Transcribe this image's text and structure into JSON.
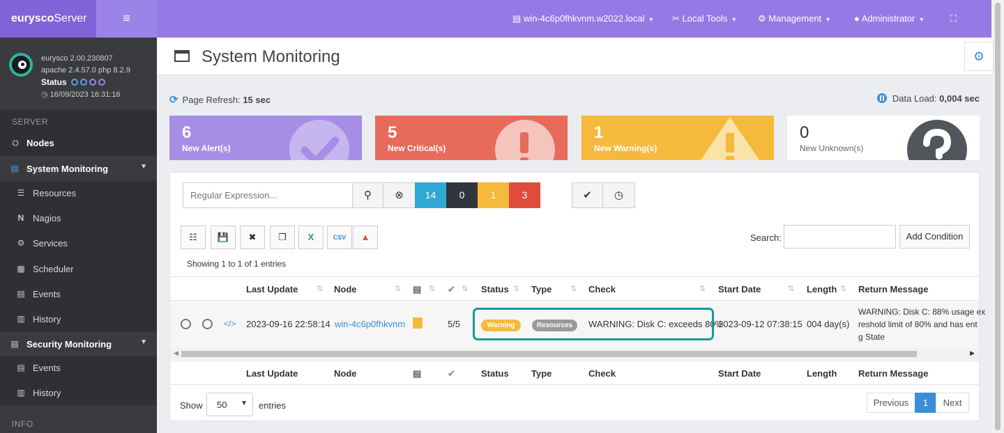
{
  "brand": {
    "name_bold": "eurysco",
    "name_thin": "Server"
  },
  "sidebar": {
    "version": "eurysco 2.00.230807",
    "stack": "apache 2.4.57.0  php 8.2.9",
    "status_label": "Status",
    "timestamp": "16/09/2023 16:31:16",
    "section_server": "SERVER",
    "nodes": "Nodes",
    "system_monitoring": "System Monitoring",
    "sys_items": [
      "Resources",
      "Nagios",
      "Services",
      "Scheduler",
      "Events",
      "History"
    ],
    "security_monitoring": "Security Monitoring",
    "sec_items": [
      "Events",
      "History"
    ],
    "section_info": "INFO"
  },
  "topbar": {
    "host": "win-4c6p0fhkvnm.w2022.local",
    "local_tools": "Local Tools",
    "management": "Management",
    "user": "Administrator"
  },
  "page": {
    "title": "System Monitoring",
    "refresh_label": "Page Refresh:",
    "refresh_value": "15 sec",
    "data_load_label": "Data Load:",
    "data_load_value": "0,004 sec"
  },
  "stats": [
    {
      "num": "6",
      "label": "New Alert(s)",
      "color": "#a78de6"
    },
    {
      "num": "5",
      "label": "New Critical(s)",
      "color": "#e76a5b"
    },
    {
      "num": "1",
      "label": "New Warning(s)",
      "color": "#f5b93b"
    },
    {
      "num": "0",
      "label": "New Unknown(s)",
      "color": "#ffffff"
    }
  ],
  "filters": {
    "regex_placeholder": "Regular Expression...",
    "counts": [
      {
        "value": "14",
        "color": "#2fa8d6"
      },
      {
        "value": "0",
        "color": "#31353d"
      },
      {
        "value": "1",
        "color": "#f5b93b"
      },
      {
        "value": "3",
        "color": "#e04c3a"
      }
    ]
  },
  "toolbar": {
    "search_label": "Search:",
    "add_condition": "Add Condition"
  },
  "table": {
    "showing": "Showing 1 to 1 of 1 entries",
    "headers": {
      "last_update": "Last Update",
      "node": "Node",
      "status": "Status",
      "type": "Type",
      "check": "Check",
      "start_date": "Start Date",
      "length": "Length",
      "return_message": "Return Message"
    },
    "row": {
      "last_update": "2023-09-16 22:58:14",
      "node": "win-4c6p0fhkvnm",
      "attempts": "5/5",
      "status": "Warning",
      "type": "Resources",
      "check": "WARNING: Disk C: exceeds 80%",
      "start_date": "2023-09-12 07:38:15",
      "length": "004 day(s)",
      "message_l1": "WARNING: Disk C: 88% usage ex",
      "message_l2": "reshold limit of 80% and has ent",
      "message_l3": "g State"
    }
  },
  "footer": {
    "show": "Show",
    "page_size": "50",
    "entries": "entries",
    "previous": "Previous",
    "page": "1",
    "next": "Next"
  }
}
